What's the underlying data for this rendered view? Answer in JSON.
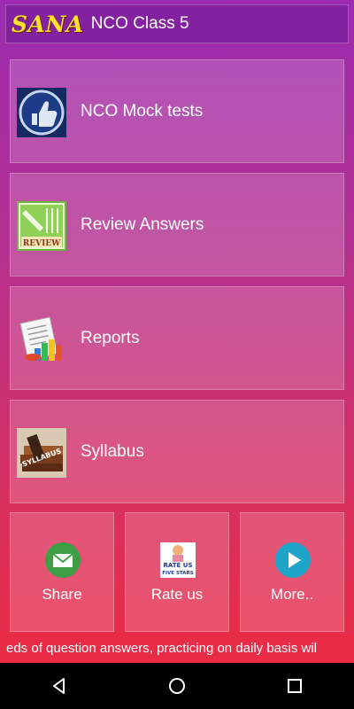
{
  "header": {
    "logo": "SANA",
    "title": "NCO Class 5"
  },
  "menu": [
    {
      "label": "NCO Mock tests",
      "icon": "thumbs-up-icon"
    },
    {
      "label": "Review Answers",
      "icon": "review-icon"
    },
    {
      "label": "Reports",
      "icon": "reports-icon"
    },
    {
      "label": "Syllabus",
      "icon": "syllabus-icon"
    }
  ],
  "bottom": [
    {
      "label": "Share",
      "icon": "mail-icon"
    },
    {
      "label": "Rate us",
      "icon": "rate-us-icon",
      "badge_line1": "RATE US",
      "badge_line2": "FIVE STARS"
    },
    {
      "label": "More..",
      "icon": "play-icon"
    }
  ],
  "ticker": "eds of question answers, practicing on daily basis wil",
  "nav": {
    "back": "back-icon",
    "home": "home-icon",
    "recents": "recents-icon"
  }
}
